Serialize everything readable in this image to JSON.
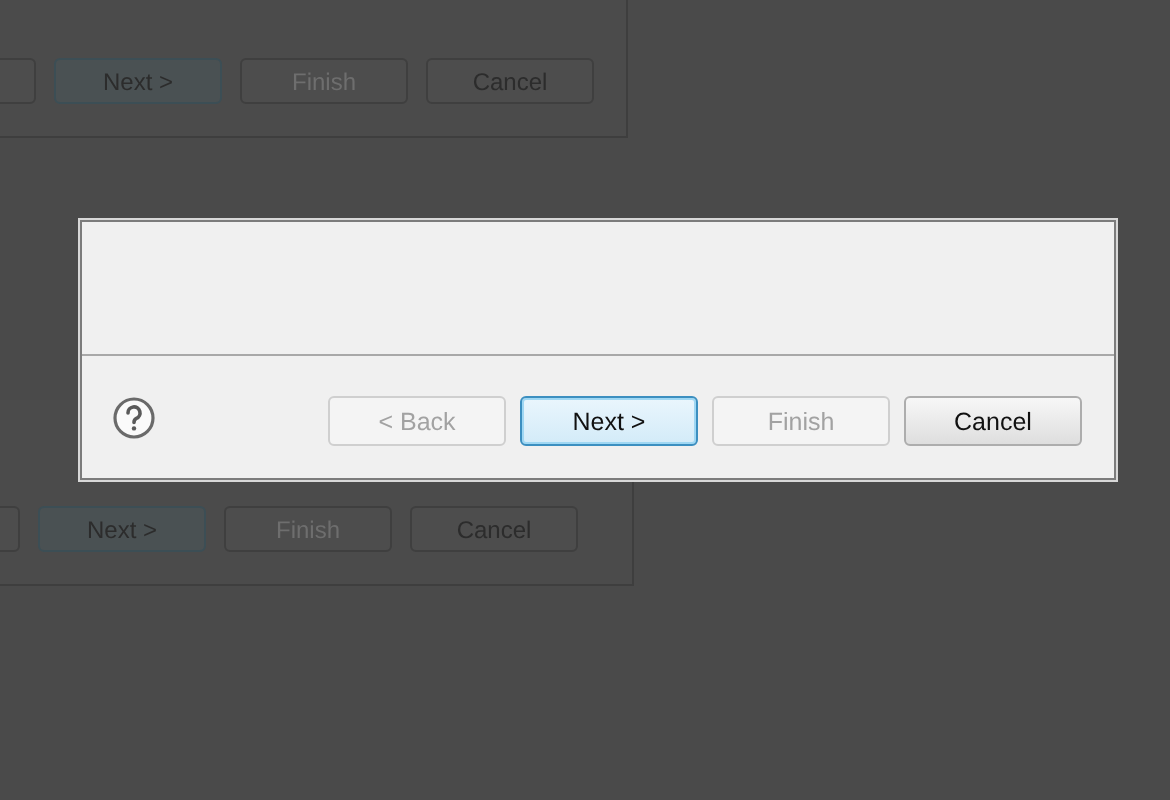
{
  "background_dialogs": [
    {
      "buttons": [
        {
          "label": "Next >",
          "default": true,
          "disabled": false
        },
        {
          "label": "Finish",
          "default": false,
          "disabled": true
        },
        {
          "label": "Cancel",
          "default": false,
          "disabled": false
        }
      ]
    },
    {
      "buttons": [
        {
          "label": "Next >",
          "default": true,
          "disabled": false
        },
        {
          "label": "Finish",
          "default": false,
          "disabled": true
        },
        {
          "label": "Cancel",
          "default": false,
          "disabled": false
        }
      ]
    }
  ],
  "dialog": {
    "buttons": [
      {
        "label": "< Back",
        "default": false,
        "disabled": true
      },
      {
        "label": "Next >",
        "default": true,
        "disabled": false
      },
      {
        "label": "Finish",
        "default": false,
        "disabled": true
      },
      {
        "label": "Cancel",
        "default": false,
        "disabled": false
      }
    ]
  }
}
